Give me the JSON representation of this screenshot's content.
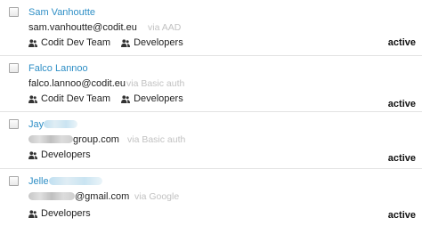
{
  "users": [
    {
      "name": "Sam Vanhoutte",
      "email": "sam.vanhoutte@codit.eu",
      "auth": "via AAD",
      "groups": [
        "Codit Dev Team",
        "Developers"
      ],
      "status": "active"
    },
    {
      "name": "Falco Lannoo",
      "email": "falco.lannoo@codit.eu",
      "auth": "via Basic auth",
      "groups": [
        "Codit Dev Team",
        "Developers"
      ],
      "status": "active"
    },
    {
      "name": "Jay",
      "email": "group.com",
      "auth": "via Basic auth",
      "groups": [
        "Developers"
      ],
      "status": "active"
    },
    {
      "name": "Jelle",
      "email": "@gmail.com",
      "auth": "via Google",
      "groups": [
        "Developers"
      ],
      "status": "active"
    }
  ],
  "icons": {
    "group": "user-group-icon",
    "checkbox": "checkbox"
  },
  "colors": {
    "name_link": "#2f8fc6",
    "via_text": "#c2c2c2",
    "divider": "#e3e3e3"
  }
}
